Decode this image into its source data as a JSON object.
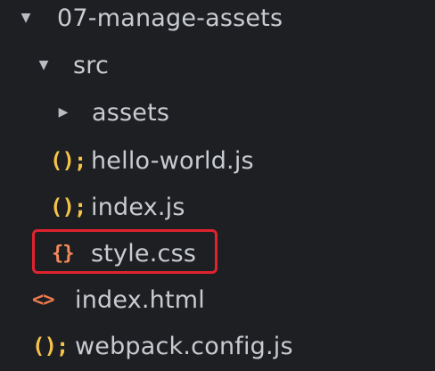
{
  "tree": {
    "root": {
      "label": "07-manage-assets",
      "expanded": true
    },
    "src": {
      "label": "src",
      "expanded": true
    },
    "assets": {
      "label": "assets",
      "expanded": false
    },
    "hello_world": {
      "label": "hello-world.js",
      "icon": "js-icon",
      "icon_glyph": "();"
    },
    "index_js": {
      "label": "index.js",
      "icon": "js-icon",
      "icon_glyph": "();"
    },
    "style_css": {
      "label": "style.css",
      "icon": "css-icon",
      "icon_glyph": "{}",
      "highlighted": true
    },
    "index_html": {
      "label": "index.html",
      "icon": "html-icon",
      "icon_glyph": "<>"
    },
    "webpack_config": {
      "label": "webpack.config.js",
      "icon": "js-icon",
      "icon_glyph": "();"
    }
  },
  "colors": {
    "background": "#1e1f22",
    "text": "#c8cbd0",
    "js_icon": "#f5c34a",
    "css_icon": "#f58a5a",
    "html_icon": "#ef7a4f",
    "highlight_border": "#e0232e"
  }
}
